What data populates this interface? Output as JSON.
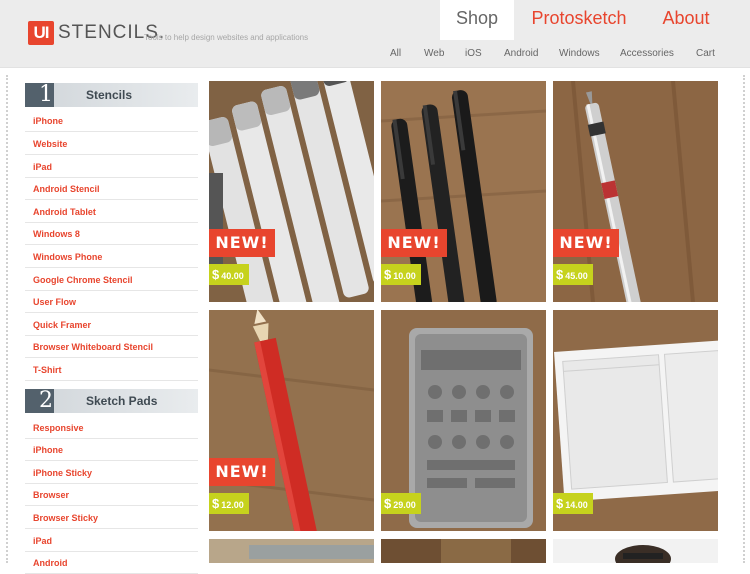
{
  "header": {
    "logo_mark": "UI",
    "logo_word": "STENCILS.",
    "tagline": "Tools to help design websites and applications",
    "main_tabs": [
      {
        "label": "Shop",
        "active": true
      },
      {
        "label": "Protosketch",
        "active": false
      },
      {
        "label": "About",
        "active": false
      }
    ],
    "subnav": [
      "All",
      "Web",
      "iOS",
      "Android",
      "Windows",
      "Accessories",
      "Cart"
    ]
  },
  "sidebar": {
    "sections": [
      {
        "number": "1",
        "title": "Stencils",
        "items": [
          "iPhone",
          "Website",
          "iPad",
          "Android Stencil",
          "Android Tablet",
          "Windows 8",
          "Windows Phone",
          "Google Chrome Stencil",
          "User Flow",
          "Quick Framer",
          "Browser Whiteboard Stencil",
          "T-Shirt"
        ]
      },
      {
        "number": "2",
        "title": "Sketch Pads",
        "items": [
          "Responsive",
          "iPhone",
          "iPhone Sticky",
          "Browser",
          "Browser Sticky",
          "iPad",
          "Android"
        ]
      }
    ]
  },
  "products": [
    {
      "kind": "markers",
      "new": true,
      "new_label": "NEW!",
      "price": "40.00"
    },
    {
      "kind": "pens",
      "new": true,
      "new_label": "NEW!",
      "price": "10.00"
    },
    {
      "kind": "mechanical-pencil",
      "new": true,
      "new_label": "NEW!",
      "price": "45.00"
    },
    {
      "kind": "red-pencil",
      "new": true,
      "new_label": "NEW!",
      "price": "12.00"
    },
    {
      "kind": "metal-stencil",
      "new": false,
      "new_label": "",
      "price": "29.00"
    },
    {
      "kind": "sketch-pad",
      "new": false,
      "new_label": "",
      "price": "14.00"
    }
  ],
  "price_symbol": "$",
  "colors": {
    "accent": "#e8452e",
    "price_bg": "#c6d21d",
    "sidebar_dark": "#53616c"
  }
}
